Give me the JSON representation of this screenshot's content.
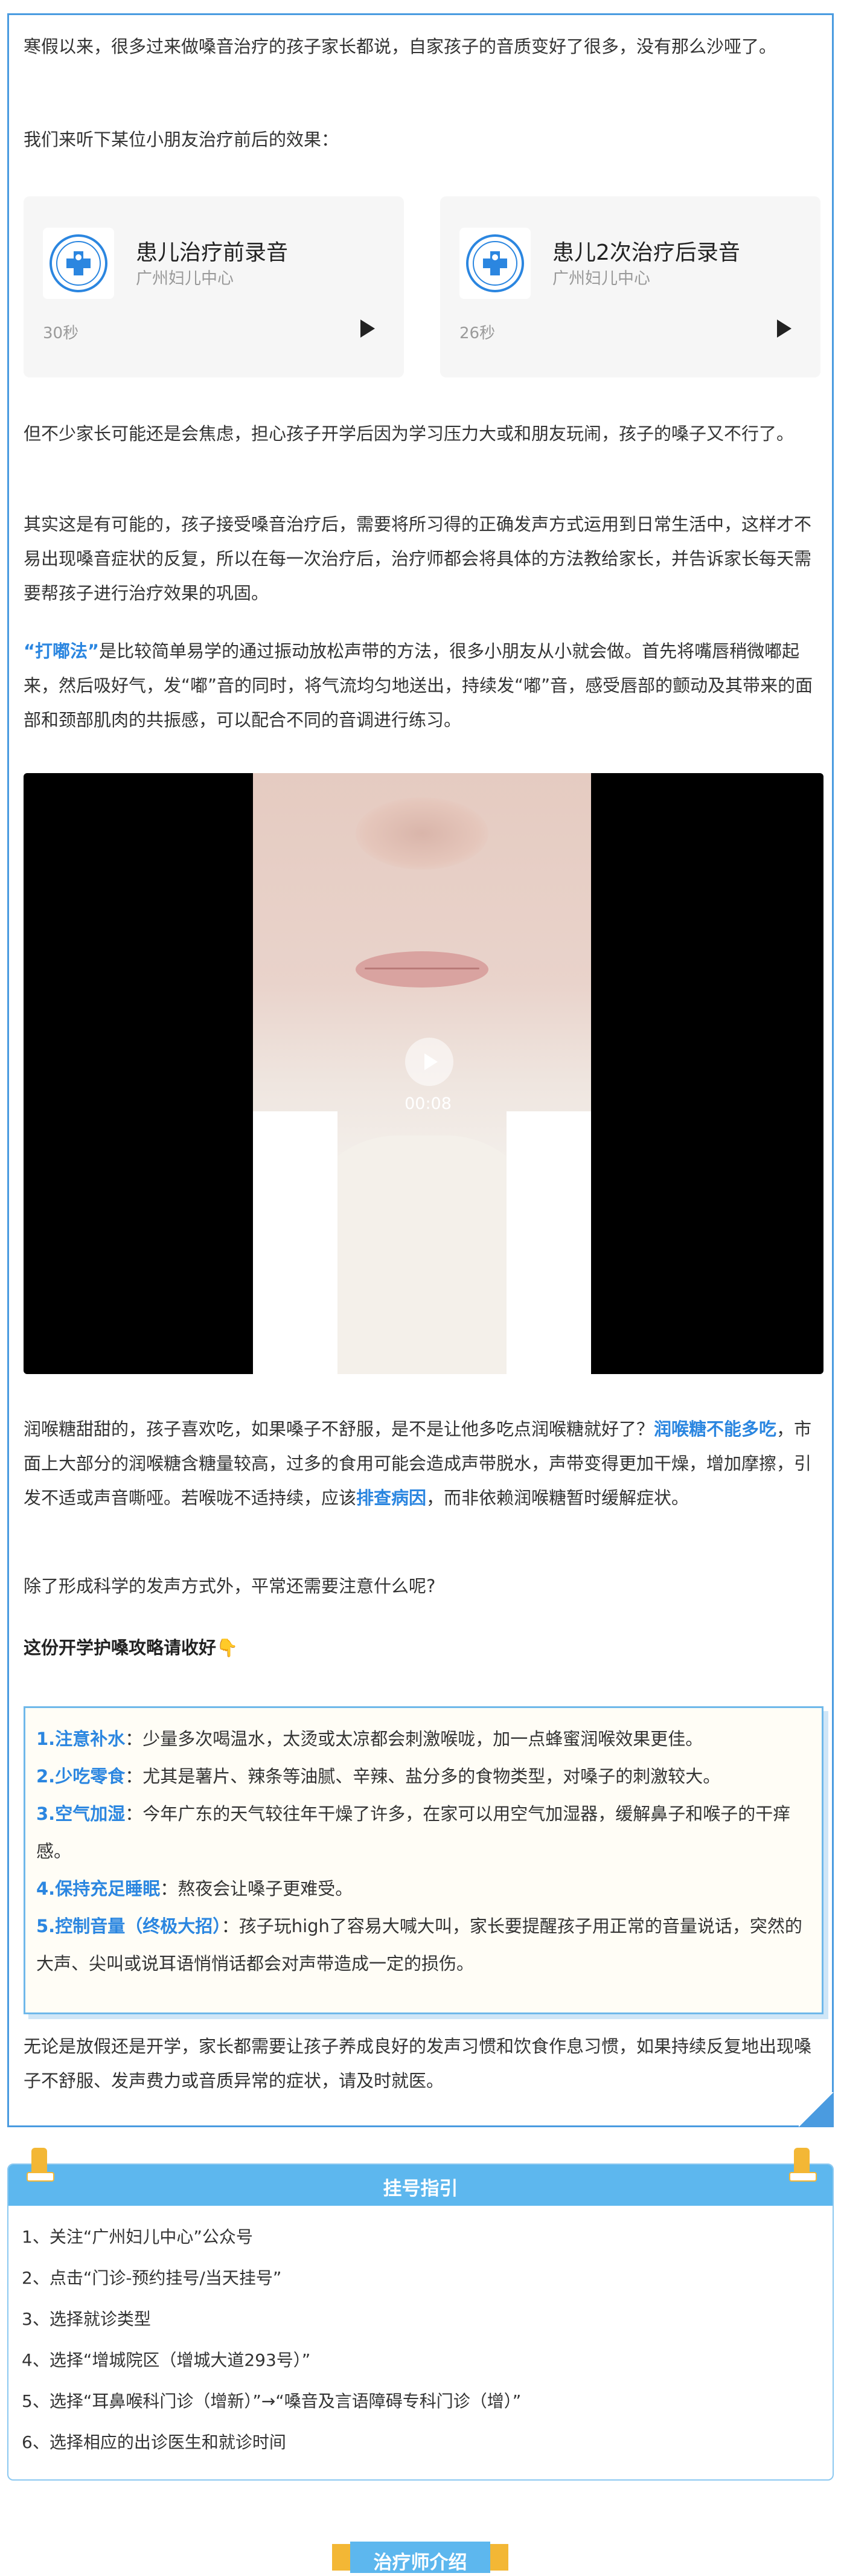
{
  "intro": {
    "p1": "寒假以来，很多过来做嗓音治疗的孩子家长都说，自家孩子的音质变好了很多，没有那么沙哑了。",
    "p2": "我们来听下某位小朋友治疗前后的效果："
  },
  "audio": [
    {
      "title": "患儿治疗前录音",
      "source": "广州妇儿中心",
      "duration": "30秒"
    },
    {
      "title": "患儿2次治疗后录音",
      "source": "广州妇儿中心",
      "duration": "26秒"
    }
  ],
  "body": {
    "p3": "但不少家长可能还是会焦虑，担心孩子开学后因为学习压力大或和朋友玩闹，孩子的嗓子又不行了。",
    "p4": "其实这是有可能的，孩子接受嗓音治疗后，需要将所习得的正确发声方式运用到日常生活中，这样才不易出现嗓音症状的反复，所以在每一次治疗后，治疗师都会将具体的方法教给家长，并告诉家长每天需要帮孩子进行治疗效果的巩固。",
    "p5_hl": "“打嘟法”",
    "p5": "是比较简单易学的通过振动放松声带的方法，很多小朋友从小就会做。首先将嘴唇稍微嘟起来，然后吸好气，发“嘟”音的同时，将气流均匀地送出，持续发“嘟”音，感受唇部的颤动及其带来的面部和颈部肌肉的共振感，可以配合不同的音调进行练习。",
    "video_time": "00:08",
    "p6a": "润喉糖甜甜的，孩子喜欢吃，如果嗓子不舒服，是不是让他多吃点润喉糖就好了？",
    "p6_hl1": "润喉糖不能多吃",
    "p6b": "，市面上大部分的润喉糖含糖量较高，过多的食用可能会造成声带脱水，声带变得更加干燥，增加摩擦，引发不适或声音嘶哑。若喉咙不适持续，应该",
    "p6_hl2": "排查病因",
    "p6c": "，而非依赖润喉糖暂时缓解症状。",
    "p7": "除了形成科学的发声方式外，平常还需要注意什么呢?",
    "p8": "这份开学护嗓攻略请收好👇"
  },
  "tips": [
    {
      "head": "1.注意补水",
      "text": "：少量多次喝温水，太烫或太凉都会刺激喉咙，加一点蜂蜜润喉效果更佳。"
    },
    {
      "head": "2.少吃零食",
      "text": "：尤其是薯片、辣条等油腻、辛辣、盐分多的食物类型，对嗓子的刺激较大。"
    },
    {
      "head": "3.空气加湿",
      "text": "：今年广东的天气较往年干燥了许多，在家可以用空气加湿器，缓解鼻子和喉子的干痒感。"
    },
    {
      "head": "4.保持充足睡眠",
      "text": "：熬夜会让嗓子更难受。"
    },
    {
      "head": "5.控制音量（终极大招）",
      "text": "：孩子玩high了容易大喊大叫，家长要提醒孩子用正常的音量说话，突然的大声、尖叫或说耳语悄悄话都会对声带造成一定的损伤。"
    }
  ],
  "closing": "无论是放假还是开学，家长都需要让孩子养成良好的发声习惯和饮食作息习惯，如果持续反复地出现嗓子不舒服、发声费力或音质异常的症状，请及时就医。",
  "guide": {
    "title": "挂号指引",
    "steps": [
      "1、关注“广州妇儿中心”公众号",
      "2、点击“门诊-预约挂号/当天挂号”",
      "3、选择就诊类型",
      "4、选择“增城院区（增城大道293号）”",
      "5、选择“耳鼻喉科门诊（增新）”→“嗓音及言语障碍专科门诊（增）”",
      "6、选择相应的出诊医生和就诊时间"
    ]
  },
  "doctor_intro": "治疗师介绍",
  "colors": {
    "accent": "#2b86e0",
    "frame": "#4a9be0",
    "guide_head": "#5db7ee",
    "pin": "#f3b735"
  }
}
